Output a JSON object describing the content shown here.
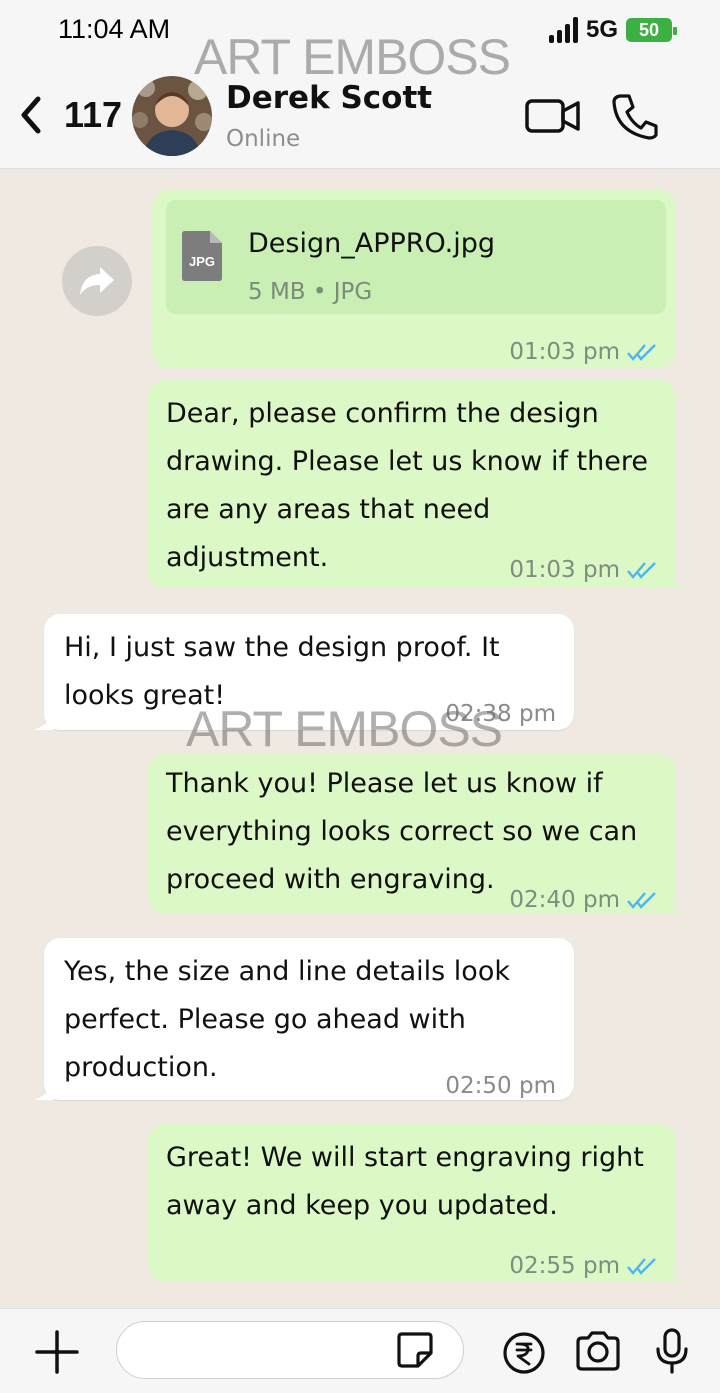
{
  "status_bar": {
    "time": "11:04 AM",
    "network": "5G",
    "battery": "50"
  },
  "header": {
    "back_count": "117",
    "contact_name": "Derek Scott",
    "contact_status": "Online"
  },
  "watermark": "ART EMBOSS",
  "file_message": {
    "file_name": "Design_APPRO.jpg",
    "file_meta": "5 MB • JPG",
    "file_type_badge": "JPG",
    "time": "01:03 pm"
  },
  "messages": [
    {
      "direction": "out",
      "text": "Dear, please confirm the design\ndrawing. Please let us know if there\nare any areas that need\nadjustment.",
      "time": "01:03 pm"
    },
    {
      "direction": "in",
      "text": "Hi, I just saw the design proof. It\nlooks great!",
      "time": "02:38 pm"
    },
    {
      "direction": "out",
      "text": "Thank you! Please let us know if\neverything looks correct so we can\nproceed with engraving.",
      "time": "02:40 pm"
    },
    {
      "direction": "in",
      "text": "Yes, the size and line details look\nperfect. Please go ahead with\nproduction.",
      "time": "02:50 pm"
    },
    {
      "direction": "out",
      "text": "Great! We will start engraving right\naway and keep you updated.",
      "time": "02:55 pm"
    }
  ],
  "composer": {
    "placeholder": ""
  },
  "icons": [
    "back-chevron-icon",
    "video-call-icon",
    "phone-icon",
    "forward-icon",
    "file-icon",
    "read-ticks-icon",
    "plus-icon",
    "sticker-icon",
    "rupee-icon",
    "camera-icon",
    "mic-icon"
  ],
  "colors": {
    "outgoing_bubble": "#dcf8c6",
    "incoming_bubble": "#ffffff",
    "read_ticks": "#4fb6ec",
    "background": "#efe9e1"
  }
}
